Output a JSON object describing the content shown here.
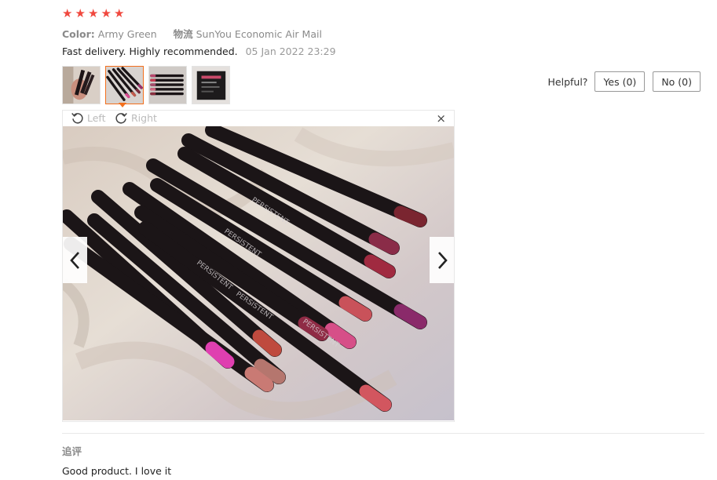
{
  "review": {
    "rating": 5,
    "color_label": "Color:",
    "color_value": "Army Green",
    "shipping_label": "物流",
    "shipping_value": "SunYou Economic Air Mail",
    "text": "Fast delivery. Highly recommended.",
    "date": "05 Jan 2022 23:29",
    "thumbnails": [
      "thumbnail-1",
      "thumbnail-2",
      "thumbnail-3",
      "thumbnail-4"
    ],
    "active_thumbnail": 2
  },
  "helpful": {
    "label": "Helpful?",
    "yes": "Yes (0)",
    "no": "No (0)"
  },
  "viewer": {
    "rotate_left": "Left",
    "rotate_right": "Right",
    "close": "×"
  },
  "followup": {
    "label": "追评",
    "text": "Good product. I love it"
  },
  "colors": {
    "star": "#f0483e",
    "active_border": "#f36f1c"
  }
}
